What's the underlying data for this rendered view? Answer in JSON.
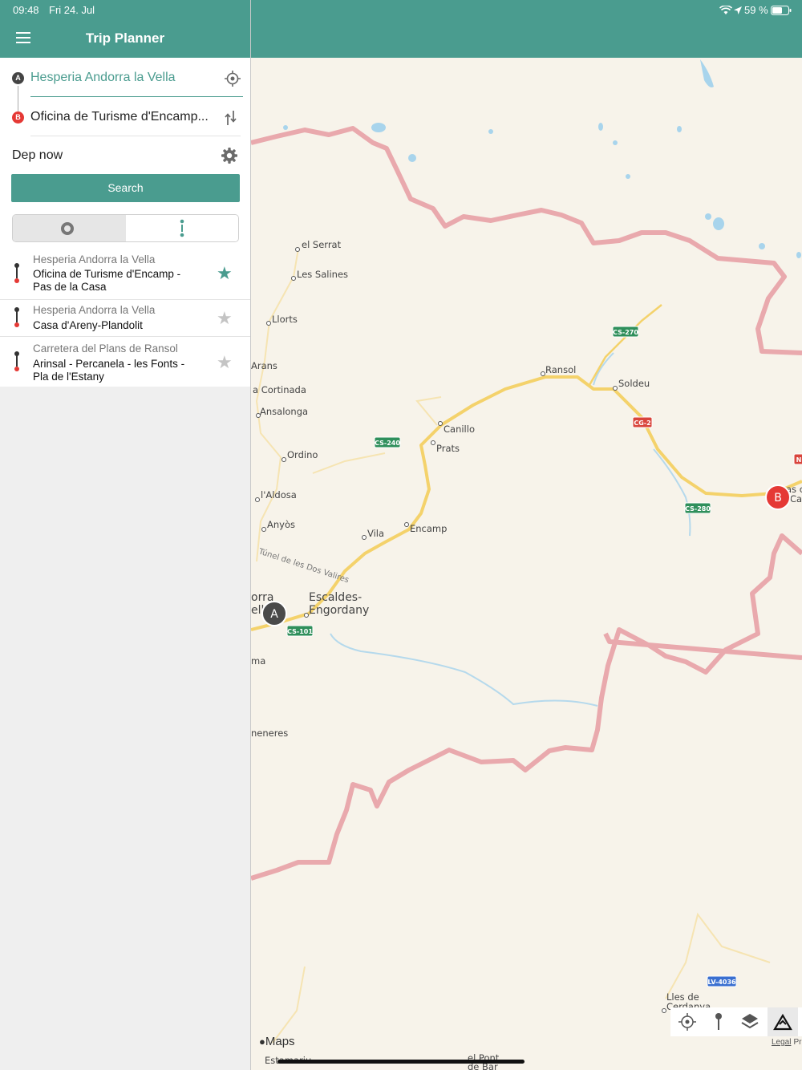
{
  "status": {
    "time": "09:48",
    "date": "Fri 24. Jul",
    "battery": "59 %"
  },
  "header": {
    "title": "Trip Planner"
  },
  "trip": {
    "from_badge": "A",
    "to_badge": "B",
    "from_value": "Hesperia Andorra la Vella",
    "to_value": "Oficina de Turisme d'Encamp...",
    "departure_label": "Dep now",
    "search_label": "Search"
  },
  "favorites": [
    {
      "from": "Hesperia Andorra la Vella",
      "to": "Oficina de Turisme d'Encamp -\nPas de la Casa",
      "starred": true
    },
    {
      "from": "Hesperia Andorra la Vella",
      "to": "Casa d'Areny-Plandolit",
      "starred": false
    },
    {
      "from": "Carretera del Plans de Ransol",
      "to": "Arinsal - Percanela - les Fonts -\nPla de l'Estany",
      "starred": false
    }
  ],
  "map": {
    "labels": {
      "el_serrat": "el Serrat",
      "les_salines": "Les Salines",
      "llorts": "Llorts",
      "arans": "Arans",
      "cortinada": "a Cortinada",
      "ansalonga": "Ansalonga",
      "ordino": "Ordino",
      "aldosa": "l'Aldosa",
      "anyos": "Anyòs",
      "tunel": "Túnel de les Dos Valires",
      "vila": "Vila",
      "encamp": "Encamp",
      "canillo": "Canillo",
      "prats": "Prats",
      "ransol": "Ransol",
      "soldeu": "Soldeu",
      "escaldes1": "Escaldes-",
      "escaldes2": "Engordany",
      "orra": "orra",
      "ell": "ell",
      "ma": "ma",
      "neneres": "neneres",
      "lles1": "Lles de",
      "lles2": "Cerdanya",
      "el_pont": "el Pont",
      "de_bar": "de Bar",
      "estamariu": "Estamariu",
      "as_c": "as c",
      "ca": "Ca"
    },
    "road_badges": {
      "cs270": "CS-270",
      "cg2": "CG-2",
      "cs240": "CS-240",
      "cs280": "CS-280",
      "cs101": "CS-101",
      "lv4036": "LV-4036",
      "n": "N"
    },
    "pin_a": "A",
    "pin_b": "B",
    "attribution": "Maps",
    "legal": "Legal",
    "legal_cut": "Pr"
  },
  "colors": {
    "teal": "#4a9c8f",
    "route_red": "#e53935",
    "road_yellow": "#f4d26b",
    "border_pink": "#e9a9ad"
  }
}
